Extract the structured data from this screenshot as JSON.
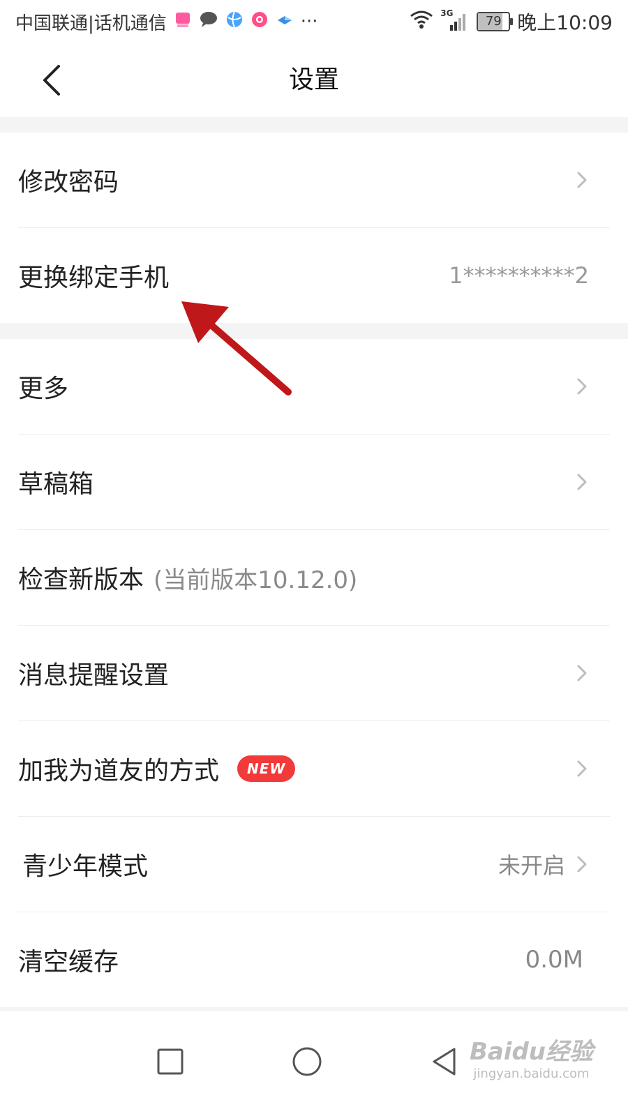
{
  "status_bar": {
    "carrier": "中国联通|话机通信",
    "app_icons": [
      "shop-app-icon",
      "chat-bubble-icon",
      "globe-app-icon",
      "camera-app-icon",
      "bird-app-icon"
    ],
    "more": "···",
    "network": "3G",
    "battery": "79",
    "battery_level": 0.79,
    "time": "晚上10:09"
  },
  "nav": {
    "title": "设置"
  },
  "settings": {
    "group1": [
      {
        "label": "修改密码"
      },
      {
        "label": "更换绑定手机",
        "value": "1**********2"
      }
    ],
    "group2": [
      {
        "label": "更多"
      },
      {
        "label": "草稿箱"
      },
      {
        "label": "检查新版本",
        "sub": "(当前版本10.12.0)"
      },
      {
        "label": "消息提醒设置"
      },
      {
        "label": "加我为道友的方式",
        "badge": "NEW"
      },
      {
        "label": "青少年模式",
        "value": "未开启"
      },
      {
        "label": "清空缓存",
        "value": "0.0M"
      }
    ]
  },
  "watermark": {
    "line1": "Baidu经验",
    "line2": "jingyan.baidu.com"
  },
  "colors": {
    "badge": "#f23a3a",
    "annotation_arrow": "#c0181a",
    "background": "#f4f4f4"
  }
}
